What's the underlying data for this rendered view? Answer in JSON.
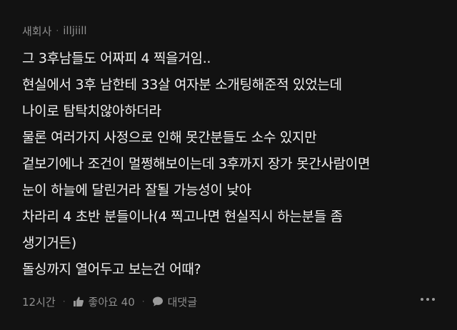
{
  "comment": {
    "category": "새회사",
    "author": "illjiill",
    "lines": [
      "그 3후남들도 어짜피 4 찍을거임..",
      "현실에서 3후 남한테 33살 여자분 소개팅해준적 있었는데",
      "나이로 탐탁치않아하더라",
      "물론 여러가지 사정으로 인해 못간분들도 소수 있지만",
      "겉보기에나 조건이 멀쩡해보이는데 3후까지 장가 못간사람이면",
      "눈이 하늘에 달린거라 잘될 가능성이 낮아",
      "차라리 4 초반 분들이나(4 찍고나면 현실직시 하는분들 좀",
      "생기거든)",
      "돌싱까지 열어두고 보는건 어때?"
    ],
    "time": "12시간",
    "like_label": "좋아요 40",
    "reply_label": "대댓글",
    "more_icon": "more-horizontal-icon",
    "like_icon": "thumbs-up-icon",
    "reply_icon": "speech-bubble-icon"
  },
  "colors": {
    "background": "#121212",
    "text": "#f1f1f1",
    "muted": "#8f8f8f"
  }
}
